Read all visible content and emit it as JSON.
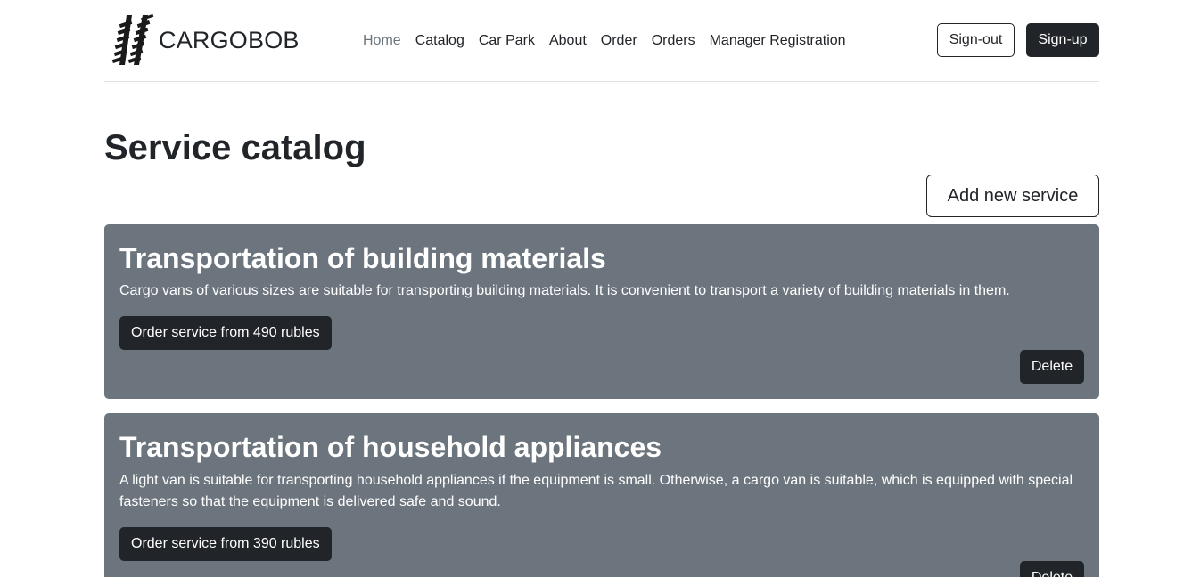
{
  "brand": {
    "name": "CARGOBOB",
    "logo_icon": "tire-tracks-icon"
  },
  "nav": {
    "items": [
      {
        "label": "Home",
        "active": true
      },
      {
        "label": "Catalog"
      },
      {
        "label": "Car Park"
      },
      {
        "label": "About"
      },
      {
        "label": "Order"
      },
      {
        "label": "Orders"
      },
      {
        "label": "Manager Registration"
      }
    ]
  },
  "auth": {
    "signout_label": "Sign-out",
    "signup_label": "Sign-up"
  },
  "page": {
    "title": "Service catalog",
    "add_label": "Add new service"
  },
  "services": [
    {
      "title": "Transportation of building materials",
      "description": "Cargo vans of various sizes are suitable for transporting building materials. It is convenient to transport a variety of building materials in them.",
      "order_label": "Order service from 490 rubles",
      "delete_label": "Delete"
    },
    {
      "title": "Transportation of household appliances",
      "description": "A light van is suitable for transporting household appliances if the equipment is small. Otherwise, a cargo van is suitable, which is equipped with special fasteners so that the equipment is delivered safe and sound.",
      "order_label": "Order service from 390 rubles",
      "delete_label": "Delete"
    }
  ],
  "colors": {
    "card_bg": "#6c757d",
    "dark": "#212529",
    "muted": "#6c757d"
  }
}
